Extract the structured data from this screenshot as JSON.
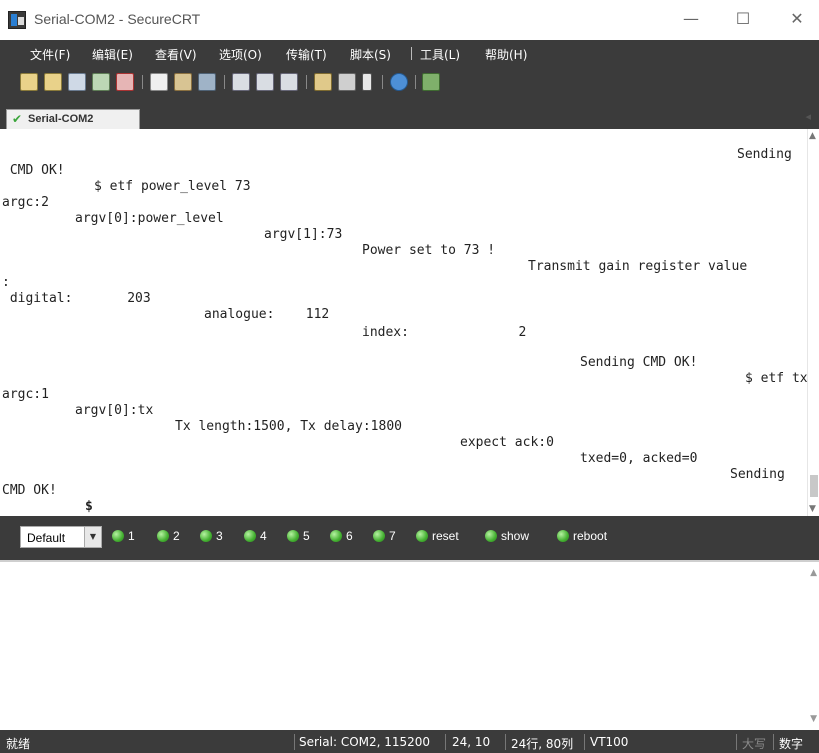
{
  "window": {
    "title": "Serial-COM2 - SecureCRT",
    "minimize_label": "—",
    "maximize_label": "☐",
    "close_label": "✕"
  },
  "menu": [
    "文件(F)",
    "编辑(E)",
    "查看(V)",
    "选项(O)",
    "传输(T)",
    "脚本(S)",
    "工具(L)",
    "帮助(H)"
  ],
  "toolbar_icons": [
    "connect-icon",
    "quick-connect-icon",
    "connect-tab-icon",
    "reconnect-icon",
    "disconnect-icon",
    "copy-icon",
    "paste-icon",
    "find-icon",
    "print-icon",
    "print-selection-icon",
    "print-setup-icon",
    "session-options-icon",
    "global-options-icon",
    "keymap-icon",
    "help-icon",
    "sftp-icon"
  ],
  "tab": {
    "label": "Serial-COM2",
    "status": "connected"
  },
  "terminal_lines": [
    {
      "text": "Sending",
      "col": 0
    },
    {
      "text": " CMD OK!",
      "col": 0
    },
    {
      "text": "$ etf power_level 73",
      "col": 0
    },
    {
      "text": "argc:2",
      "col": 0
    },
    {
      "text": "argv[0]:power_level",
      "col": 0
    },
    {
      "text": "argv[1]:73",
      "col": 0
    },
    {
      "text": "Power set to 73 !",
      "col": 0
    },
    {
      "text": "Transmit gain register value",
      "col": 0
    },
    {
      "text": ":",
      "col": 0
    },
    {
      "text": " digital:       203",
      "col": 0
    },
    {
      "text": "analogue:    112",
      "col": 0
    },
    {
      "text": "index:              2",
      "col": 0
    },
    {
      "text": "Sending CMD OK!",
      "col": 0
    },
    {
      "text": "$ etf tx",
      "col": 0
    },
    {
      "text": "argc:1",
      "col": 0
    },
    {
      "text": "argv[0]:tx",
      "col": 0
    },
    {
      "text": "Tx length:1500, Tx delay:1800",
      "col": 0
    },
    {
      "text": "expect ack:0",
      "col": 0
    },
    {
      "text": "txed=0, acked=0",
      "col": 0
    },
    {
      "text": "Sending",
      "col": 0
    },
    {
      "text": "CMD OK!",
      "col": 0
    },
    {
      "text": "$",
      "col": 0
    }
  ],
  "button_bar": {
    "selected": "Default",
    "buttons": [
      "1",
      "2",
      "3",
      "4",
      "5",
      "6",
      "7",
      "reset",
      "show",
      "reboot"
    ]
  },
  "statusbar": {
    "ready": "就绪",
    "connection": "Serial: COM2, 115200",
    "cursor": "24, 10",
    "size": "24行, 80列",
    "emulation": "VT100",
    "caps": "大写",
    "num": "数字"
  },
  "colors": {
    "chrome": "#3b3b3b",
    "status_ok": "#43b030"
  }
}
